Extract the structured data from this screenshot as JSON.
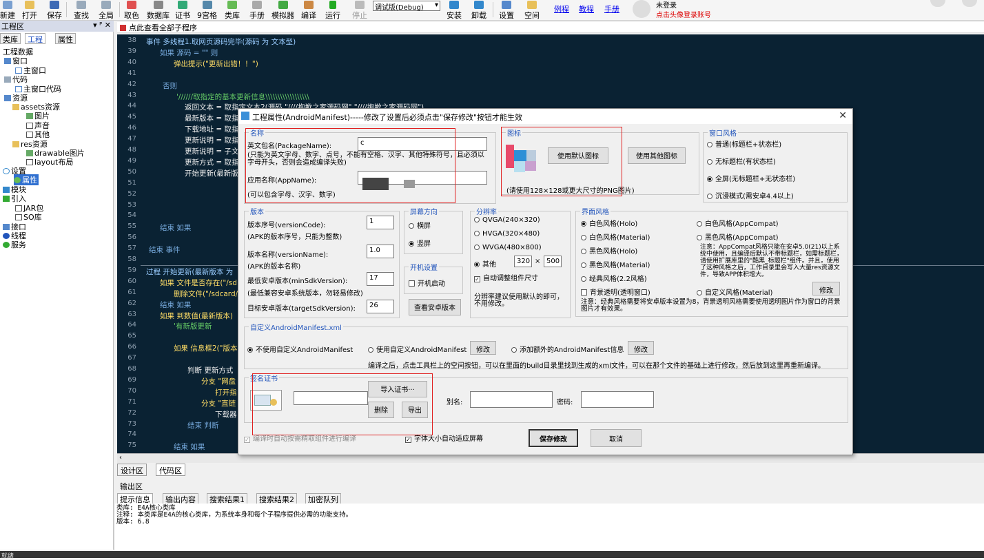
{
  "toolbar": {
    "items": [
      "新建",
      "打开",
      "保存",
      "查找",
      "全局",
      "取色",
      "数据库",
      "证书",
      "9宫格",
      "类库",
      "手册",
      "模拟器",
      "编译",
      "运行",
      "停止",
      "安装",
      "卸载",
      "设置",
      "空间"
    ],
    "build_mode": "调试版(Debug)",
    "links": [
      "例程",
      "教程",
      "手册"
    ],
    "user": "未登录",
    "login_hint": "点击头像登录账号"
  },
  "left": {
    "header": "工程区",
    "pin": "▾ ᴾ ✕",
    "tabs": [
      "类库",
      "工程",
      "属性"
    ],
    "tree": [
      "工程数据",
      "窗口",
      "主窗口",
      "代码",
      "主窗口代码",
      "资源",
      "assets资源",
      "图片",
      "声音",
      "其他",
      "res资源",
      "drawable图片",
      "layout布局",
      "设置",
      "属性",
      "模块",
      "引入",
      "JAR包",
      "SO库",
      "接口",
      "线程",
      "服务"
    ]
  },
  "editor": {
    "header": "点此查看全部子程序",
    "line_numbers": [
      "38",
      "39",
      "40",
      "41",
      "42",
      "43",
      "44",
      "45",
      "46",
      "47",
      "48",
      "49",
      "50",
      "51",
      "52",
      "53",
      "54",
      "55",
      "56",
      "57",
      "58",
      "59",
      "60",
      "61",
      "62",
      "63",
      "64",
      "65",
      "66",
      "67",
      "68",
      "69",
      "70",
      "71",
      "72",
      "73",
      "74",
      "75"
    ],
    "lines": [
      "事件 多线程1.取网页源码完毕(源码 为 文本型)",
      "如果 源码 = \"\" 则",
      "弹出提示(\"更新出错！！\")",
      "",
      "否则",
      "'//////取指定的基本更新信息\\\\\\\\\\\\\\\\\\\\\\\\\\\\\\\\\\\\",
      "返回文本 = 取指定文本2(源码,\"////抱歉之家源码网\",\"////抱歉之家源码网\")",
      "最新版本 = 取指",
      "下载地址 = 取指",
      "更新说明 = 取指",
      "更新说明 = 子文",
      "更新方式 = 取指",
      "开始更新(最新版",
      "",
      "",
      "",
      "",
      "结束 如果",
      "",
      "结束 事件",
      "",
      "过程 开始更新(最新版本 为",
      "如果 文件是否存在(\"/sd",
      "删除文件(\"/sdcard/",
      "结束 如果",
      "如果 到数值(最新版本)",
      "'有新版更新",
      "",
      "如果 信息框2(\"版本",
      "",
      "判断 更新方式",
      "分支 \"网盘",
      "打开指",
      "分支 \"直链",
      "下载器",
      "结束 判断",
      "",
      "结束 如果"
    ],
    "bottom_tabs": [
      "设计区",
      "代码区"
    ]
  },
  "output": {
    "header": "输出区",
    "tabs": [
      "提示信息",
      "输出内容",
      "搜索结果1",
      "搜索结果2",
      "加密队列"
    ],
    "lines": [
      "类库: E4A核心类库",
      "注释: 本类库是E4A的核心类库，为系统本身和每个子程序提供必需的功能支持。",
      "版本: 6.8"
    ]
  },
  "dialog": {
    "title": "工程属性(AndroidManifest)-----修改了设置后必须点击\"保存修改\"按钮才能生效",
    "name_group": "名称",
    "package_label": "英文包名(PackageName):",
    "package_value": "c",
    "package_note": "(只能为英文字母、数字、点号，不能有空格、汉字、其他特殊符号，且必须以字母开头，否则会造成编译失败)",
    "app_label": "应用名称(AppName):",
    "app_note": "(可以包含字母、汉字、数字)",
    "icon_group": "图标",
    "icon_default_btn": "使用默认图标",
    "icon_other_btn": "使用其他图标",
    "icon_note": "(请使用128×128或更大尺寸的PNG图片)",
    "window_group": "窗口风格",
    "window_opts": [
      "普通(标题栏+状态栏)",
      "无标题栏(有状态栏)",
      "全屏(无标题栏+无状态栏)",
      "沉浸模式(需安卓4.4以上)"
    ],
    "version_group": "版本",
    "version_code_label": "版本序号(versionCode):",
    "version_code": "1",
    "version_code_note": "(APK的版本序号，只能为整数)",
    "version_name_label": "版本名称(versionName):",
    "version_name": "1.0",
    "version_name_note": "(APK的版本名称)",
    "min_sdk_label": "最低安卓版本(minSdkVersion):",
    "min_sdk": "17",
    "min_sdk_note": "(最低兼容安卓系统版本，勿轻易修改)",
    "target_sdk_label": "目标安卓版本(targetSdkVersion):",
    "target_sdk": "26",
    "orient_group": "屏幕方向",
    "orient_opts": [
      "横屏",
      "竖屏"
    ],
    "boot_group": "开机设置",
    "boot_opt": "开机启动",
    "view_android_btn": "查看安卓版本",
    "res_group": "分辨率",
    "res_opts": [
      "QVGA(240×320)",
      "HVGA(320×480)",
      "WVGA(480×800)",
      "其他"
    ],
    "res_w": "320",
    "res_h": "500",
    "res_times": "×",
    "auto_size": "自动调整组件尺寸",
    "res_note": "分辨率建议使用默认的即可，不用修改。",
    "theme_group": "界面风格",
    "theme_left": [
      "白色风格(Holo)",
      "白色风格(Material)",
      "黑色风格(Holo)",
      "黑色风格(Material)",
      "经典风格(2.2风格)",
      "背景透明(透明窗口)"
    ],
    "theme_right": [
      "白色风格(AppCompat)",
      "黑色风格(AppCompat)",
      "自定义风格(Material)"
    ],
    "theme_note1": "注意：AppCompat风格只能在安卓5.0(21)以上系统中使用，且编译后默认不带标题栏，如需标题栏，请使用扩展库里的\"酷黑_标题栏\"组件。并且，使用了这种风格之后，工作目录里会写入大量res资源文件，导致APP体积增大。",
    "theme_modify": "修改",
    "theme_note2": "注意：经典风格需要将安卓版本设置为8，背景透明风格需要使用透明图片作为窗口的背景图片才有效果。",
    "manifest_group": "自定义AndroidManifest.xml",
    "manifest_opts": [
      "不使用自定义AndroidManifest",
      "使用自定义AndroidManifest",
      "添加额外的AndroidManifest信息"
    ],
    "manifest_modify": "修改",
    "manifest_note": "编译之后，点击工具栏上的空间按钮，可以在里面的build目录里找到生成的xml文件，可以在那个文件的基础上进行修改，然后放到这里再重新编译。",
    "cert_group": "签名证书",
    "import_btn": "导入证书···",
    "delete_btn": "删除",
    "export_btn": "导出",
    "alias_label": "别名:",
    "password_label": "密码:",
    "chk_compile": "编译时自动按需精取组件进行编译",
    "chk_font": "字体大小自动适应屏幕",
    "save_btn": "保存修改",
    "cancel_btn": "取消"
  },
  "status": "就绪"
}
